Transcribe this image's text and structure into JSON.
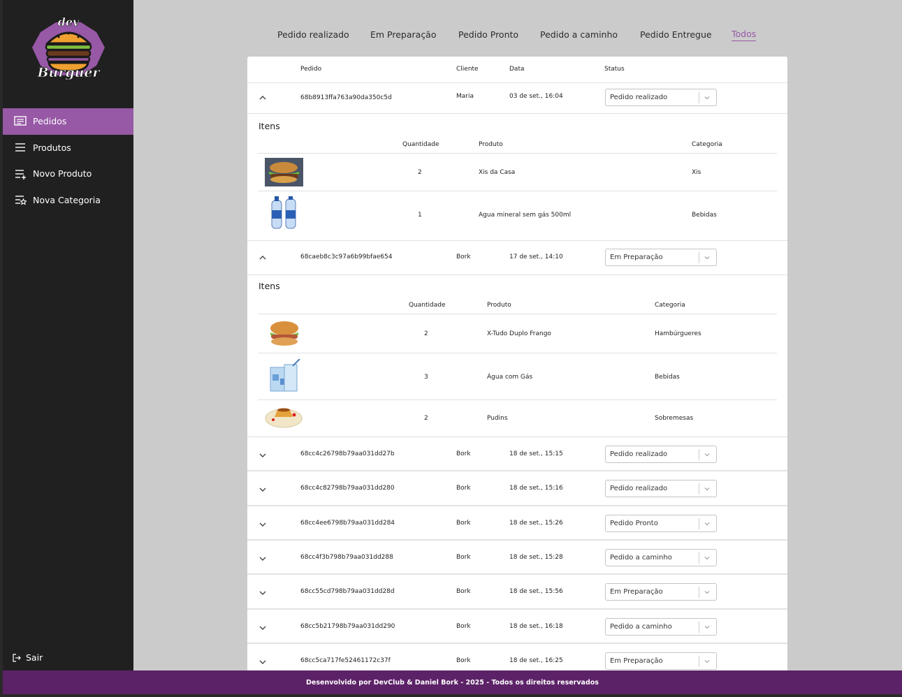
{
  "brand": {
    "logo_top": "dev",
    "logo_bottom": "Burguer"
  },
  "sidebar": {
    "items": [
      {
        "label": "Pedidos",
        "icon": "receipt-icon",
        "active": true
      },
      {
        "label": "Produtos",
        "icon": "list-icon",
        "active": false
      },
      {
        "label": "Novo Produto",
        "icon": "playlist-add-icon",
        "active": false
      },
      {
        "label": "Nova Categoria",
        "icon": "playlist-star-icon",
        "active": false
      }
    ],
    "logout_label": "Sair"
  },
  "tabs": [
    "Pedido realizado",
    "Em Preparação",
    "Pedido Pronto",
    "Pedido a caminho",
    "Pedido Entregue",
    "Todos"
  ],
  "active_tab": "Todos",
  "table": {
    "headers": {
      "order": "Pedido",
      "client": "Cliente",
      "date": "Data",
      "status": "Status"
    },
    "items_title": "Itens",
    "items_headers": {
      "qty": "Quantidade",
      "product": "Produto",
      "category": "Categoria"
    },
    "orders": [
      {
        "id": "68b8913ffa763a90da350c5d",
        "client": "Maria",
        "date": "03 de set., 16:04",
        "status": "Pedido realizado",
        "expanded": true,
        "items": [
          {
            "image": "burger-photo",
            "qty": "2",
            "product": "Xis da Casa",
            "category": "Xis"
          },
          {
            "image": "water-bottles-photo",
            "qty": "1",
            "product": "Agua mineral sem gás 500ml",
            "category": "Bebidas"
          }
        ]
      },
      {
        "id": "68caeb8c3c97a6b99bfae654",
        "client": "Bork",
        "date": "17 de set., 14:10",
        "status": "Em Preparação",
        "expanded": true,
        "items": [
          {
            "image": "chicken-burger-photo",
            "qty": "2",
            "product": "X-Tudo Duplo Frango",
            "category": "Hambúrgueres"
          },
          {
            "image": "sparkling-water-photo",
            "qty": "3",
            "product": "Água com Gás",
            "category": "Bebidas"
          },
          {
            "image": "pudding-photo",
            "qty": "2",
            "product": "Pudins",
            "category": "Sobremesas"
          }
        ]
      },
      {
        "id": "68cc4c26798b79aa031dd27b",
        "client": "Bork",
        "date": "18 de set., 15:15",
        "status": "Pedido realizado",
        "expanded": false
      },
      {
        "id": "68cc4c82798b79aa031dd280",
        "client": "Bork",
        "date": "18 de set., 15:16",
        "status": "Pedido realizado",
        "expanded": false
      },
      {
        "id": "68cc4ee6798b79aa031dd284",
        "client": "Bork",
        "date": "18 de set., 15:26",
        "status": "Pedido Pronto",
        "expanded": false
      },
      {
        "id": "68cc4f3b798b79aa031dd288",
        "client": "Bork",
        "date": "18 de set., 15:28",
        "status": "Pedido a caminho",
        "expanded": false
      },
      {
        "id": "68cc55cd798b79aa031dd28d",
        "client": "Bork",
        "date": "18 de set., 15:56",
        "status": "Em Preparação",
        "expanded": false
      },
      {
        "id": "68cc5b21798b79aa031dd290",
        "client": "Bork",
        "date": "18 de set., 16:18",
        "status": "Pedido a caminho",
        "expanded": false
      },
      {
        "id": "68cc5ca717fe52461172c37f",
        "client": "Bork",
        "date": "18 de set., 16:25",
        "status": "Em Preparação",
        "expanded": false
      }
    ]
  },
  "footer": {
    "text": "Desenvolvido por DevClub & Daniel Bork - 2025 - Todos os direitos reservados"
  },
  "colors": {
    "accent": "#9758a6",
    "footer": "#5c2267",
    "sidebar": "#202020"
  }
}
